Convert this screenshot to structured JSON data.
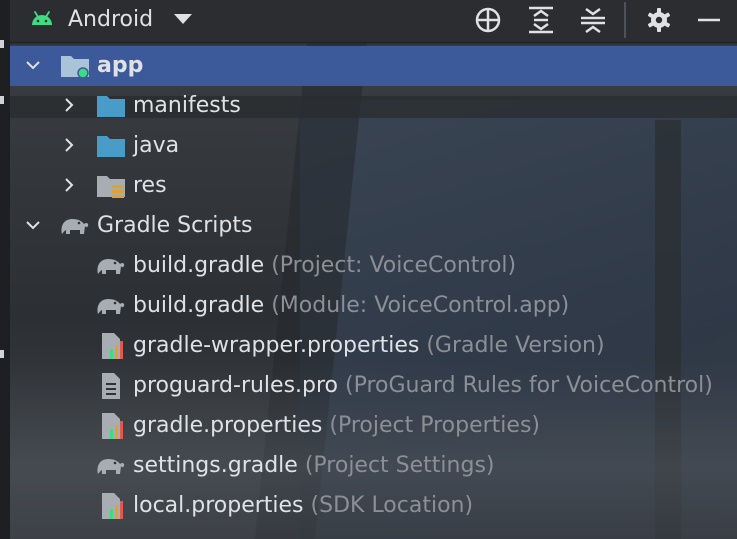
{
  "toolbar": {
    "view_label": "Android",
    "icons": [
      "android-icon",
      "dropdown-arrow-icon",
      "locate-icon",
      "expand-all-icon",
      "collapse-all-icon",
      "gear-icon",
      "minimize-icon"
    ]
  },
  "tree": {
    "app": {
      "label": "app",
      "expanded": true,
      "selected": true
    },
    "manifests": {
      "label": "manifests",
      "expanded": false
    },
    "java": {
      "label": "java",
      "expanded": false
    },
    "res": {
      "label": "res",
      "expanded": false
    },
    "gradle_scripts": {
      "label": "Gradle Scripts",
      "expanded": true
    },
    "files": [
      {
        "name": "build.gradle",
        "hint": "(Project: VoiceControl)",
        "icon": "gradle-elephant-icon"
      },
      {
        "name": "build.gradle",
        "hint": "(Module: VoiceControl.app)",
        "icon": "gradle-elephant-icon"
      },
      {
        "name": "gradle-wrapper.properties",
        "hint": "(Gradle Version)",
        "icon": "properties-file-icon"
      },
      {
        "name": "proguard-rules.pro",
        "hint": "(ProGuard Rules for VoiceControl)",
        "icon": "text-file-icon"
      },
      {
        "name": "gradle.properties",
        "hint": "(Project Properties)",
        "icon": "properties-file-icon"
      },
      {
        "name": "settings.gradle",
        "hint": "(Project Settings)",
        "icon": "gradle-elephant-icon"
      },
      {
        "name": "local.properties",
        "hint": "(SDK Location)",
        "icon": "properties-file-icon"
      }
    ]
  },
  "colors": {
    "selection": "#3c5a9a",
    "text": "#dfe1e5",
    "hint": "#8c9096",
    "folder": "#4a9cc8",
    "android_green": "#3ddc84"
  }
}
